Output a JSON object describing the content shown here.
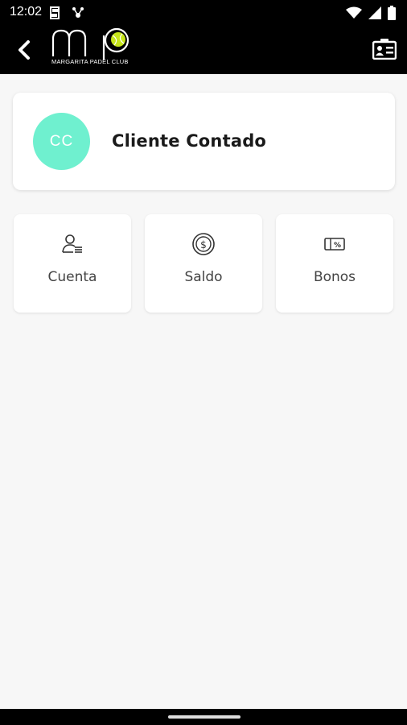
{
  "status_bar": {
    "time": "12:02"
  },
  "app_bar": {
    "logo_text": "MARGARITA PADEL CLUB",
    "brand_accent": "#c6e51a"
  },
  "user": {
    "initials": "CC",
    "name": "Cliente Contado",
    "avatar_color": "#6ff0cf"
  },
  "tiles": [
    {
      "label": "Cuenta",
      "icon": "account-list-icon"
    },
    {
      "label": "Saldo",
      "icon": "coin-dollar-icon"
    },
    {
      "label": "Bonos",
      "icon": "voucher-percent-icon"
    }
  ]
}
